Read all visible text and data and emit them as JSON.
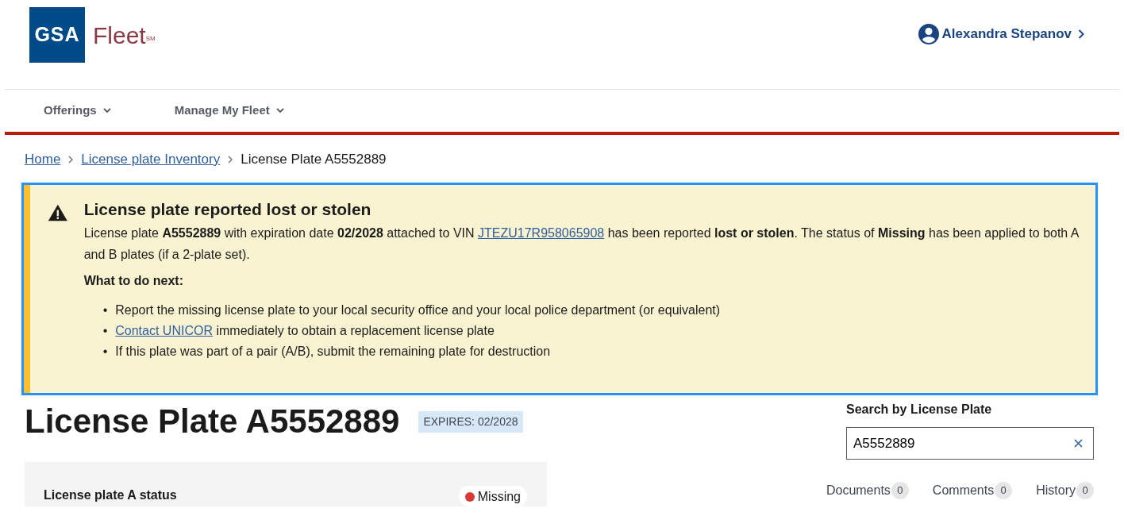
{
  "header": {
    "logo": {
      "mark": "GSA",
      "name": "Fleet",
      "service_mark": "SM"
    },
    "user": {
      "name": "Alexandra Stepanov"
    }
  },
  "nav": [
    {
      "label": "Offerings"
    },
    {
      "label": "Manage My Fleet"
    }
  ],
  "breadcrumb": [
    {
      "label": "Home",
      "kind": "link"
    },
    {
      "label": "License plate Inventory",
      "kind": "link"
    },
    {
      "label": "License Plate A5552889",
      "kind": "current"
    }
  ],
  "alert": {
    "title": "License plate reported lost or stolen",
    "message": [
      {
        "kind": "text",
        "text": "License plate **A5552889** with expiration date **02/2028** attached to VIN "
      },
      {
        "kind": "link",
        "text": "JTEZU17R958065908"
      },
      {
        "kind": "text",
        "text": " has been reported **lost or stolen**. The status of **Missing** has been applied to both A and B plates (if a 2-plate set)."
      }
    ],
    "next_heading": "What to do next:",
    "steps": [
      {
        "bullet": "•",
        "parts": [
          {
            "kind": "text",
            "text": "Report the missing license plate to your local security office and your local police department (or equivalent)"
          }
        ]
      },
      {
        "bullet": "•",
        "parts": [
          {
            "kind": "link",
            "text": "Contact UNICOR"
          },
          {
            "kind": "text",
            "text": " immediately to obtain a replacement license plate"
          }
        ]
      },
      {
        "bullet": "•",
        "parts": [
          {
            "kind": "text",
            "text": "If this plate was part of a pair (A/B), submit the remaining plate for destruction"
          }
        ]
      }
    ]
  },
  "page": {
    "title": "License Plate A5552889",
    "expires_tag": "EXPIRES: 02/2028"
  },
  "status_card": {
    "label": "License plate A status",
    "status": "Missing",
    "color": "#d83933"
  },
  "search": {
    "label": "Search by License Plate",
    "value": "A5552889"
  },
  "tabs": [
    {
      "label": "Documents",
      "count": "0"
    },
    {
      "label": "Comments",
      "count": "0"
    },
    {
      "label": "History",
      "count": "0"
    }
  ]
}
